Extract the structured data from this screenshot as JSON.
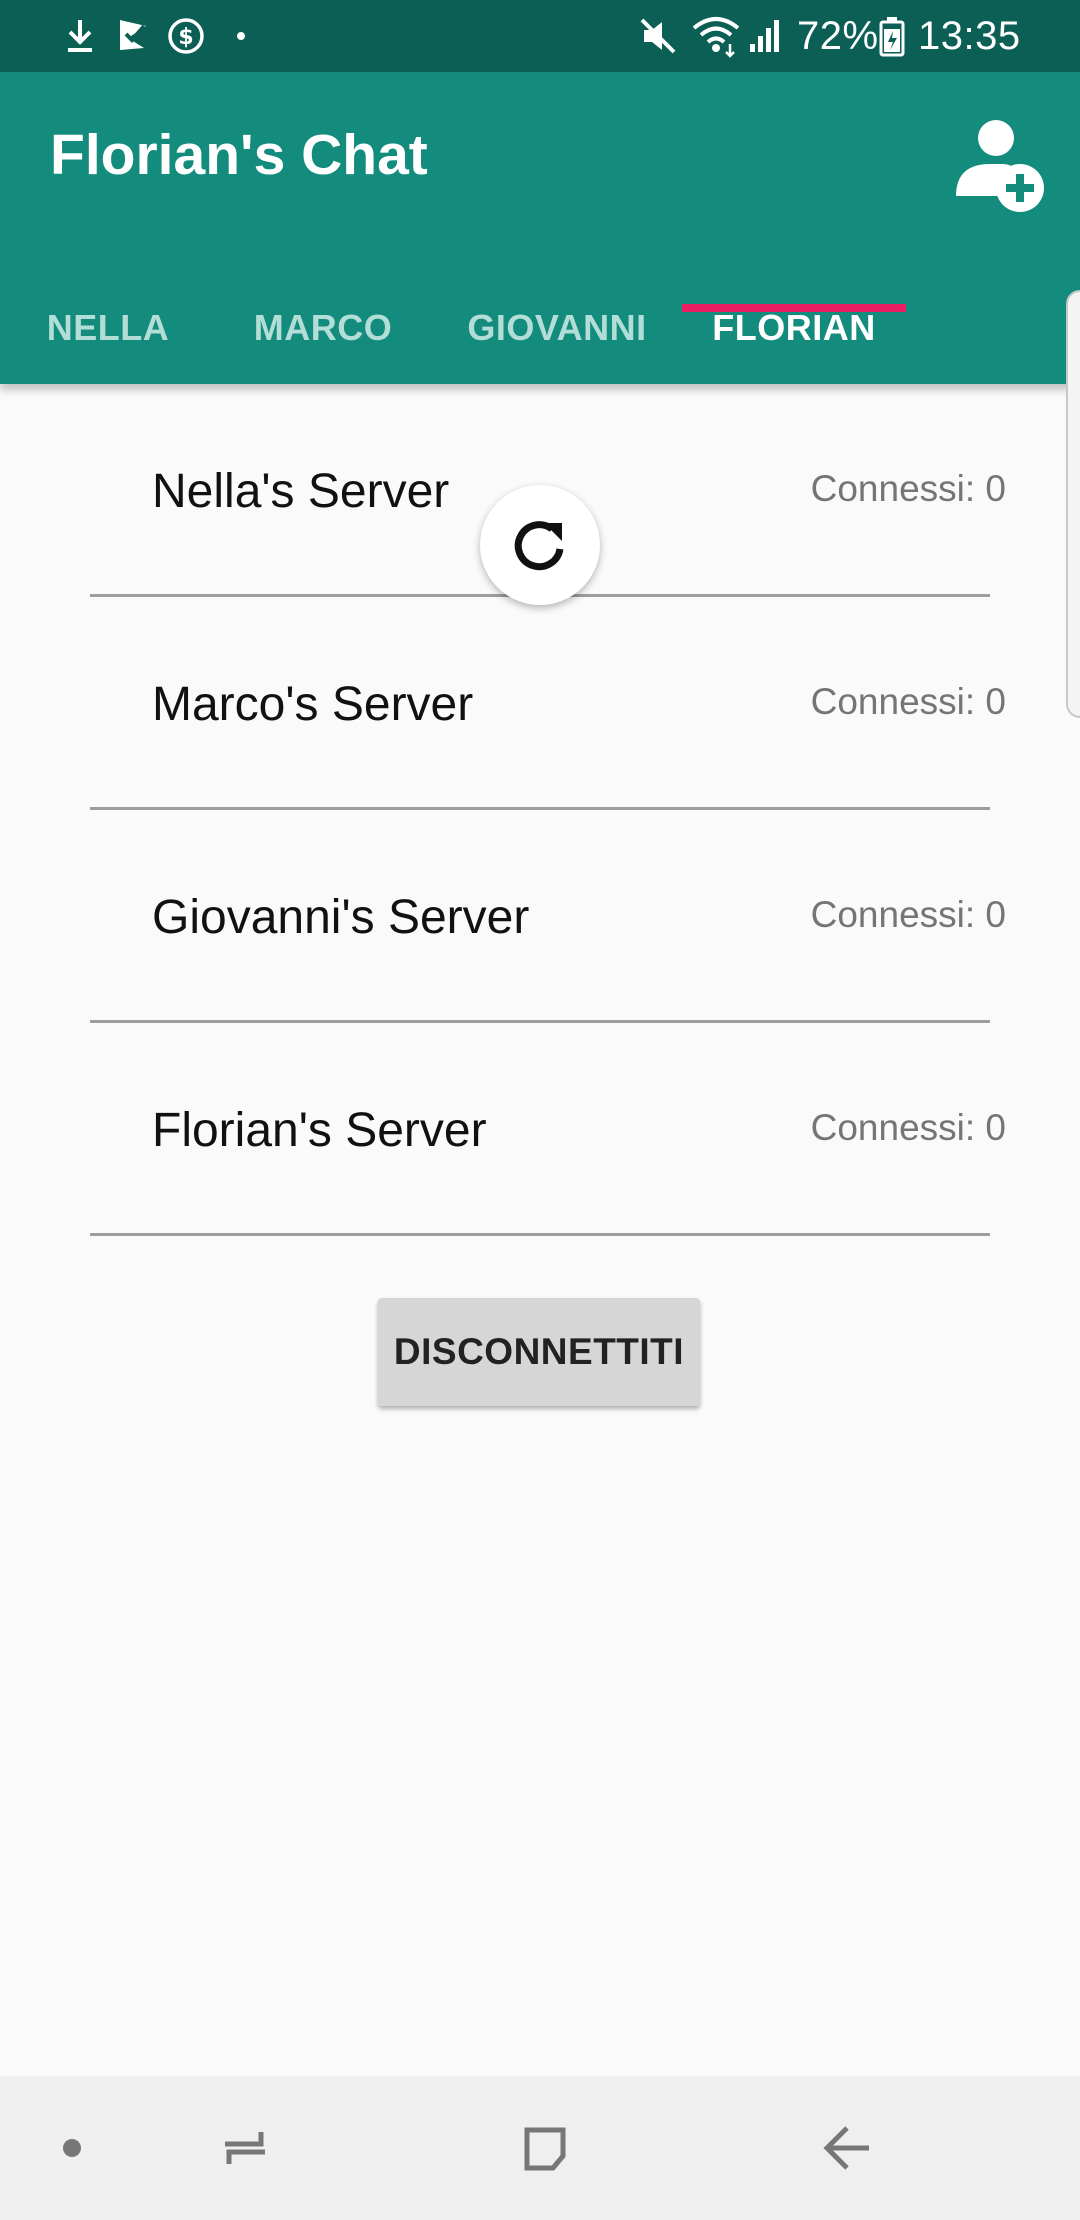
{
  "status_bar": {
    "battery": "72%",
    "time": "13:35",
    "icons": [
      "download-icon",
      "flag-icon",
      "dollar-icon",
      "dot-icon",
      "mute-icon",
      "wifi-icon",
      "signal-icon",
      "battery-icon"
    ]
  },
  "app_bar": {
    "title": "Florian's Chat",
    "action_icon": "add-user-icon",
    "background": "#138b7d"
  },
  "tabs": [
    {
      "label": "NELLA",
      "active": false
    },
    {
      "label": "MARCO",
      "active": false
    },
    {
      "label": "GIOVANNI",
      "active": false
    },
    {
      "label": "FLORIAN",
      "active": true
    }
  ],
  "accent_color": "#e91e63",
  "servers": [
    {
      "name": "Nella's Server",
      "count": "Connessi: 0"
    },
    {
      "name": "Marco's Server",
      "count": "Connessi: 0"
    },
    {
      "name": "Giovanni's Server",
      "count": "Connessi: 0"
    },
    {
      "name": "Florian's Server",
      "count": "Connessi: 0"
    }
  ],
  "refresh_icon": "refresh-icon",
  "disconnect_label": "DISCONNETTITI",
  "nav_bar": {
    "icons": [
      "dot-icon",
      "recent-apps-icon",
      "home-icon",
      "back-icon"
    ]
  }
}
